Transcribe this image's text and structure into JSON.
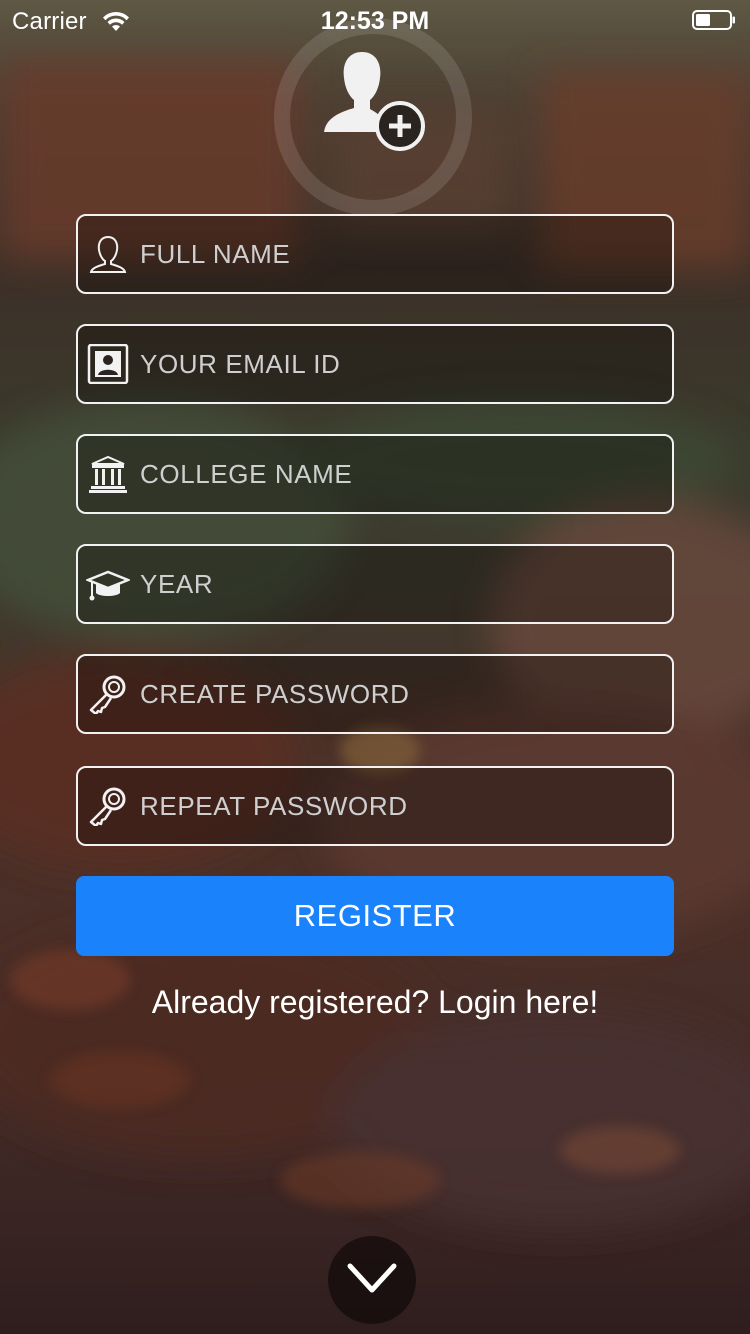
{
  "status_bar": {
    "carrier": "Carrier",
    "time": "12:53 PM"
  },
  "avatar": {
    "icon": "add-user-icon"
  },
  "form": {
    "fields": [
      {
        "placeholder": "FULL NAME",
        "icon": "user-outline-icon",
        "value": ""
      },
      {
        "placeholder": "YOUR EMAIL ID",
        "icon": "id-card-icon",
        "value": ""
      },
      {
        "placeholder": "COLLEGE NAME",
        "icon": "institution-icon",
        "value": ""
      },
      {
        "placeholder": "YEAR",
        "icon": "graduation-cap-icon",
        "value": ""
      },
      {
        "placeholder": "CREATE PASSWORD",
        "icon": "key-icon",
        "value": ""
      },
      {
        "placeholder": "REPEAT PASSWORD",
        "icon": "key-icon",
        "value": ""
      }
    ],
    "register_label": "REGISTER",
    "login_link": "Already registered? Login here!"
  },
  "scroll_down": {
    "icon": "chevron-down-icon"
  },
  "colors": {
    "primary_button": "#1a82fb",
    "field_border": "#f2f2f2",
    "background": "#3a2a24"
  }
}
